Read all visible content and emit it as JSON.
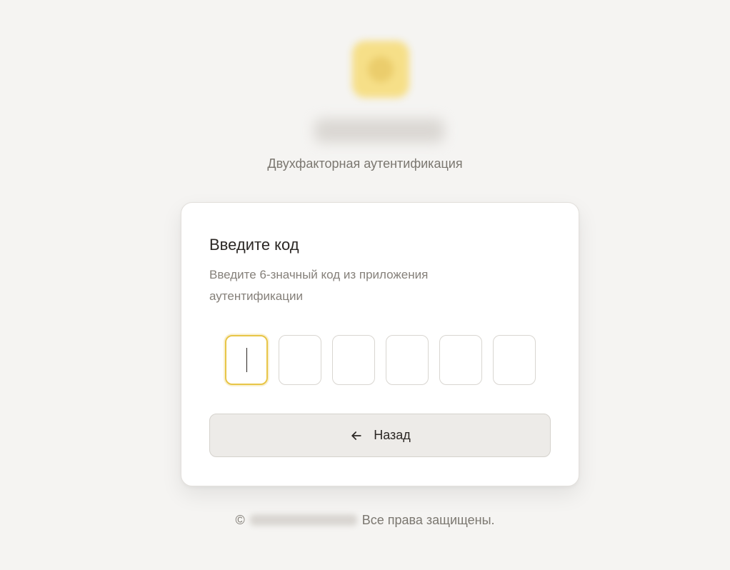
{
  "theme": {
    "background": "#f5f4f2",
    "accent": "#e8c547",
    "text": "#2a2623",
    "muted": "#85807a",
    "button_background": "#edebe8"
  },
  "header": {
    "logo_icon": "logo-icon",
    "subtitle": "Двухфакторная аутентификация"
  },
  "card": {
    "title": "Введите код",
    "description": "Введите 6-значный код из приложения аутентификации",
    "otp": {
      "values": [
        "",
        "",
        "",
        "",
        "",
        ""
      ],
      "focused_index": 0
    },
    "back_button": {
      "icon": "arrow-left-icon",
      "label": "Назад"
    }
  },
  "footer": {
    "copyright_symbol": "©",
    "rights_text": "Все права защищены."
  }
}
